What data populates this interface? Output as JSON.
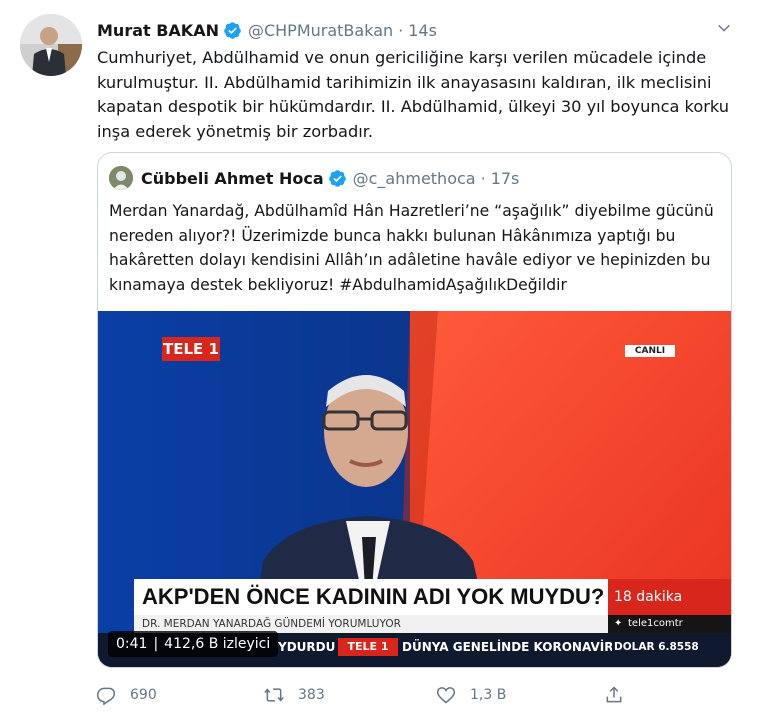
{
  "tweet": {
    "author_name": "Murat BAKAN",
    "author_handle": "@CHPMuratBakan",
    "separator": "·",
    "time": "14s",
    "text": "Cumhuriyet, Abdülhamid ve onun gericiliğine karşı verilen mücadele içinde kurulmuştur. II. Abdülhamid tarihimizin ilk anayasasını kaldıran, ilk meclisini kapatan despotik bir hükümdardır. II. Abdülhamid, ülkeyi 30 yıl boyunca korku inşa ederek yönetmiş bir zorbadır."
  },
  "quoted": {
    "author_name": "Cübbeli Ahmet Hoca",
    "author_handle": "@c_ahmethoca",
    "separator": "·",
    "time": "17s",
    "text": "Merdan Yanardağ, Abdülhamîd Hân Hazretleri’ne “aşağılık” diyebilme gücünü nereden alıyor?! Üzerimizde bunca hakkı bulunan Hâkânımıza yaptığı bu hakâretten dolayı kendisini Allâh’ın adâletine havâle ediyor ve hepinizden bu kınamaya destek bekliyoruz! #AbdulhamidAşağılıkDeğildir"
  },
  "video": {
    "channel_logo": "TELE 1",
    "live_badge": "CANLI",
    "headline": "AKP'DEN ÖNCE KADININ ADI YOK MUYDU?",
    "subheadline": "DR. MERDAN YANARDAĞ GÜNDEMİ YORUMLUYOR",
    "side_label": "18 dakika",
    "twitter_handle": "tele1comtr",
    "ticker_left": "YDURDU",
    "ticker_logo": "TELE 1",
    "ticker_text": "DÜNYA GENELİNDE KORONAVİR",
    "dolar": "DOLAR 6.8558",
    "elapsed": "0:41",
    "views": "412,6 B izleyici"
  },
  "actions": {
    "reply_count": "690",
    "retweet_count": "383",
    "like_count": "1,3 B"
  },
  "colors": {
    "verified": "#1da1f2",
    "secondary_text": "#657786",
    "border": "#ccd6dd"
  }
}
